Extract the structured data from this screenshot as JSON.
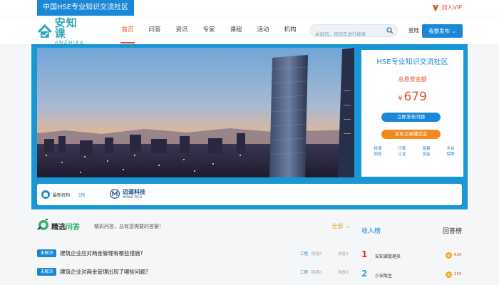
{
  "topbar": {
    "site_tag": "中国HSE专业知识交流社区",
    "vip_label": "加入VIP"
  },
  "header": {
    "logo_cn": "安知课",
    "logo_en": "ANZHIKE",
    "nav": [
      "首页",
      "问答",
      "资讯",
      "专家",
      "课程",
      "活动",
      "机构"
    ],
    "active_nav": "首页",
    "search_placeholder": "关键词，按回车进行搜索",
    "login_label": "登陆",
    "publish_label": "我要发布"
  },
  "reward_panel": {
    "title": "HSE专业知识交流社区",
    "subtitle": "总悬赏金额",
    "currency": "¥",
    "amount": "679",
    "ask_button": "立即发布问题",
    "earn_button": "发布文章赚赏金",
    "features": [
      "极速回答",
      "行家认证",
      "海量赏金",
      "平台保障"
    ]
  },
  "org_bar": {
    "label": "最新机构",
    "count": "1所",
    "org_name_cn": "迈道科技",
    "org_name_en": "MYDAO TECH"
  },
  "qa_section": {
    "title_part1": "精选",
    "title_part2": "问答",
    "subtitle": "精彩问答，总有您需要的答案！",
    "filter_label": "全部",
    "questions": [
      {
        "status": "未解决",
        "title": "建筑企业应对两金管理有哪些措施?",
        "tag": "工程",
        "answers": "回答0",
        "views": "浏览0"
      },
      {
        "status": "未解决",
        "title": "建筑企业对两金管理出现了哪些问题?",
        "tag": "工程",
        "answers": "回答0",
        "views": "浏览0"
      }
    ]
  },
  "ranking": {
    "tabs": [
      "收入榜",
      "回答榜"
    ],
    "active_tab": "收入榜",
    "entries": [
      {
        "rank": "1",
        "name": "安知课管理员",
        "score": "628",
        "color": "#e0312d"
      },
      {
        "rank": "2",
        "name": "小安版主",
        "score": "259",
        "color": "#3aa2d8"
      }
    ]
  },
  "colors": {
    "primary": "#1a87d7",
    "accent": "#e0542c",
    "orange": "#f28a1e",
    "green": "#2db36b"
  }
}
